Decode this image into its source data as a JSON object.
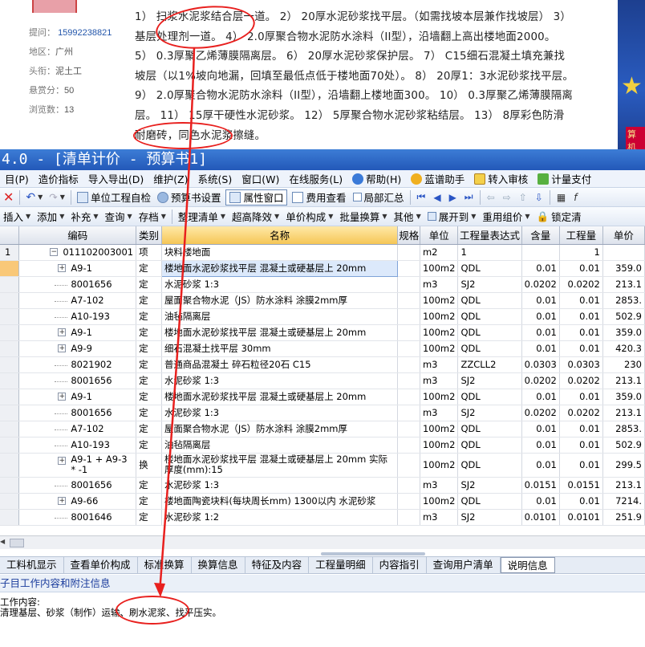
{
  "question": {
    "meta": [
      {
        "label": "提问：",
        "value": "15992238821"
      },
      {
        "label": "地区：",
        "value": "广州"
      },
      {
        "label": "头衔：",
        "value": "泥土工"
      },
      {
        "label": "悬赏分：",
        "value": "50"
      },
      {
        "label": "浏览数：",
        "value": "13"
      }
    ],
    "text": "1） 扫浆水泥浆结合层一道。 2） 20厚水泥砂浆找平层。（如需找坡本层兼作找坡层） 3） 基层处理剂一道。 4） 2.0厚聚合物水泥防水涂料（II型），沿墙翻上高出楼地面2000。 5） 0.3厚聚乙烯薄膜隔离层。 6） 20厚水泥砂浆保护层。 7） C15细石混凝土填充兼找坡层（以1%坡向地漏，回填至最低点低于楼地面70处）。 8） 20厚1：3水泥砂浆找平层。 9） 2.0厚聚合物水泥防水涂料（II型），沿墙翻上楼地面300。 10） 0.3厚聚乙烯薄膜隔离层。 11） 15厚干硬性水泥砂浆。 12） 5厚聚合物水泥砂浆粘结层。 13） 8厚彩色防滑耐磨砖，同色水泥浆擦缝。",
    "ad_text": "算机"
  },
  "app": {
    "title": "4.0 - [清单计价 - 预算书1]",
    "menu": [
      "目(P)",
      "造价指标",
      "导入导出(D)",
      "维护(Z)",
      "系统(S)",
      "窗口(W)",
      "在线服务(L)",
      "帮助(H)",
      "蓝谱助手",
      "转入审核",
      "计量支付"
    ],
    "toolbar1": {
      "check": "单位工程自检",
      "settings": "预算书设置",
      "props": "属性窗口",
      "fee": "费用查看",
      "local": "局部汇总"
    },
    "toolbar2": [
      "插入",
      "添加",
      "补充",
      "查询",
      "存档",
      "整理清单",
      "超高降效",
      "单价构成",
      "批量换算",
      "其他",
      "展开到",
      "重用组价",
      "锁定清"
    ],
    "columns": [
      "编码",
      "类别",
      "名称",
      "规格",
      "单位",
      "工程量表达式",
      "含量",
      "工程量",
      "单价"
    ],
    "rows": [
      {
        "rn": "1",
        "code": "011102003001",
        "type": "项",
        "name": "块料楼地面",
        "unit": "m2",
        "expr": "1",
        "content": "",
        "qty": "1",
        "price": "",
        "kind": "top"
      },
      {
        "rn": "",
        "code": "A9-1",
        "type": "定",
        "name": "楼地面水泥砂浆找平层 混凝土或硬基层上 20mm",
        "unit": "100m2",
        "expr": "QDL",
        "content": "0.01",
        "qty": "0.01",
        "price": "359.0",
        "kind": "plus"
      },
      {
        "rn": "",
        "code": "8001656",
        "type": "定",
        "name": "水泥砂浆 1:3",
        "unit": "m3",
        "expr": "SJ2",
        "content": "0.0202",
        "qty": "0.0202",
        "price": "213.1",
        "kind": "leaf"
      },
      {
        "rn": "",
        "code": "A7-102",
        "type": "定",
        "name": "屋面聚合物水泥（JS）防水涂料 涂膜2mm厚",
        "unit": "100m2",
        "expr": "QDL",
        "content": "0.01",
        "qty": "0.01",
        "price": "2853.",
        "kind": "leaf"
      },
      {
        "rn": "",
        "code": "A10-193",
        "type": "定",
        "name": "油毡隔离层",
        "unit": "100m2",
        "expr": "QDL",
        "content": "0.01",
        "qty": "0.01",
        "price": "502.9",
        "kind": "leaf"
      },
      {
        "rn": "",
        "code": "A9-1",
        "type": "定",
        "name": "楼地面水泥砂浆找平层 混凝土或硬基层上 20mm",
        "unit": "100m2",
        "expr": "QDL",
        "content": "0.01",
        "qty": "0.01",
        "price": "359.0",
        "kind": "plus"
      },
      {
        "rn": "",
        "code": "A9-9",
        "type": "定",
        "name": "细石混凝土找平层 30mm",
        "unit": "100m2",
        "expr": "QDL",
        "content": "0.01",
        "qty": "0.01",
        "price": "420.3",
        "kind": "plus"
      },
      {
        "rn": "",
        "code": "8021902",
        "type": "定",
        "name": "普通商品混凝土 碎石粒径20石 C15",
        "unit": "m3",
        "expr": "ZZCLL2",
        "content": "0.0303",
        "qty": "0.0303",
        "price": "230",
        "kind": "leaf"
      },
      {
        "rn": "",
        "code": "8001656",
        "type": "定",
        "name": "水泥砂浆 1:3",
        "unit": "m3",
        "expr": "SJ2",
        "content": "0.0202",
        "qty": "0.0202",
        "price": "213.1",
        "kind": "leaf"
      },
      {
        "rn": "",
        "code": "A9-1",
        "type": "定",
        "name": "楼地面水泥砂浆找平层 混凝土或硬基层上 20mm",
        "unit": "100m2",
        "expr": "QDL",
        "content": "0.01",
        "qty": "0.01",
        "price": "359.0",
        "kind": "plus"
      },
      {
        "rn": "",
        "code": "8001656",
        "type": "定",
        "name": "水泥砂浆 1:3",
        "unit": "m3",
        "expr": "SJ2",
        "content": "0.0202",
        "qty": "0.0202",
        "price": "213.1",
        "kind": "leaf"
      },
      {
        "rn": "",
        "code": "A7-102",
        "type": "定",
        "name": "屋面聚合物水泥（JS）防水涂料 涂膜2mm厚",
        "unit": "100m2",
        "expr": "QDL",
        "content": "0.01",
        "qty": "0.01",
        "price": "2853.",
        "kind": "leaf"
      },
      {
        "rn": "",
        "code": "A10-193",
        "type": "定",
        "name": "油毡隔离层",
        "unit": "100m2",
        "expr": "QDL",
        "content": "0.01",
        "qty": "0.01",
        "price": "502.9",
        "kind": "leaf"
      },
      {
        "rn": "",
        "code": "A9-1 + A9-3 * -1",
        "type": "换",
        "name": "楼地面水泥砂浆找平层 混凝土或硬基层上 20mm 实际厚度(mm):15",
        "unit": "100m2",
        "expr": "QDL",
        "content": "0.01",
        "qty": "0.01",
        "price": "299.5",
        "kind": "plus",
        "tall": true
      },
      {
        "rn": "",
        "code": "8001656",
        "type": "定",
        "name": "水泥砂浆 1:3",
        "unit": "m3",
        "expr": "SJ2",
        "content": "0.0151",
        "qty": "0.0151",
        "price": "213.1",
        "kind": "leaf"
      },
      {
        "rn": "",
        "code": "A9-66",
        "type": "定",
        "name": "楼地面陶瓷块料(每块周长mm) 1300以内 水泥砂浆",
        "unit": "100m2",
        "expr": "QDL",
        "content": "0.01",
        "qty": "0.01",
        "price": "7214.",
        "kind": "plus"
      },
      {
        "rn": "",
        "code": "8001646",
        "type": "定",
        "name": "水泥砂浆 1:2",
        "unit": "m3",
        "expr": "SJ2",
        "content": "0.0101",
        "qty": "0.0101",
        "price": "251.9",
        "kind": "leaf"
      }
    ],
    "bottom_tabs": [
      "工料机显示",
      "查看单价构成",
      "标准换算",
      "换算信息",
      "特征及内容",
      "工程量明细",
      "内容指引",
      "查询用户清单",
      "说明信息"
    ],
    "info_title": "子目工作内容和附注信息",
    "info_label": "工作内容:",
    "info_text": "清理基层、砂浆（制作）运输、刷水泥浆、找平压实。"
  },
  "colors": {
    "title_bar": "#2358b8",
    "annotation": "#e8201e",
    "selection": "#f9c878"
  }
}
